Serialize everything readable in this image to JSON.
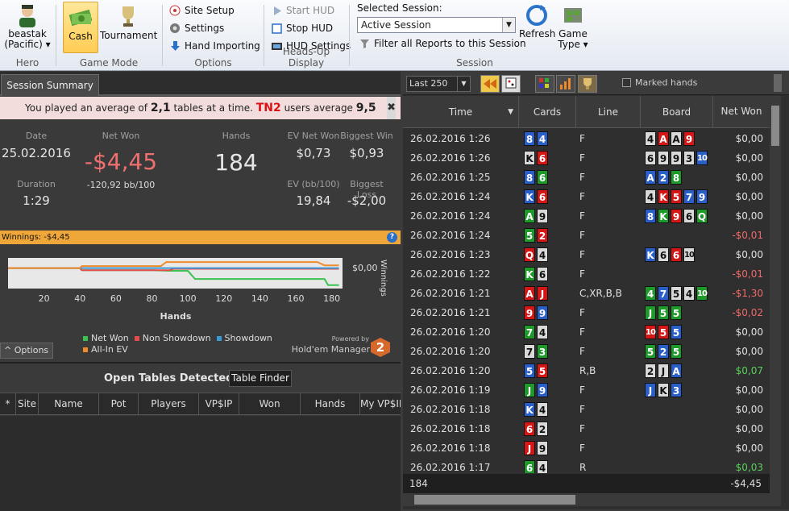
{
  "ribbon": {
    "hero": {
      "name": "beastak",
      "site": "(Pacific)",
      "group": "Hero"
    },
    "game_mode": {
      "cash": "Cash",
      "tournament": "Tournament",
      "group": "Game Mode"
    },
    "options": {
      "site_setup": "Site Setup",
      "settings": "Settings",
      "hand_importing": "Hand Importing",
      "group": "Options"
    },
    "hud": {
      "start": "Start HUD",
      "stop": "Stop HUD",
      "settings": "HUD Settings",
      "group": "Heads-Up Display"
    },
    "session": {
      "label": "Selected Session:",
      "value": "Active Session",
      "filter": "Filter all Reports to this Session",
      "refresh": "Refresh",
      "game_type": "Game Type",
      "group": "Session"
    }
  },
  "summary": {
    "tab": "Session Summary",
    "notice_pre": "You played an average of",
    "notice_tables": "2,1",
    "notice_mid": "tables at a time.",
    "notice_tn": "TN2",
    "notice_post": "users average",
    "notice_avg": "9,5",
    "date_label": "Date",
    "date": "25.02.2016",
    "duration_label": "Duration",
    "duration": "1:29",
    "netwon_label": "Net Won",
    "netwon": "-$4,45",
    "netwon_bb": "-120,92 bb/100",
    "hands_label": "Hands",
    "hands": "184",
    "ev_label": "EV Net Won",
    "ev": "$0,73",
    "evbb_label": "EV (bb/100)",
    "evbb": "19,84",
    "bigwin_label": "Biggest Win",
    "bigwin": "$0,93",
    "bigloss_label": "Biggest Loss",
    "bigloss": "-$2,00",
    "winnings_bar": "Winnings: -$4,45",
    "options": "Options",
    "powered": "Powered by",
    "hm": "Hold'em Manager",
    "hm_num": "2"
  },
  "chart_data": {
    "type": "line",
    "xlabel": "Hands",
    "ylabel": "Winnings",
    "y_tick": "$0,00",
    "x": [
      20,
      40,
      60,
      80,
      100,
      120,
      140,
      160,
      180
    ],
    "xlim": [
      0,
      186
    ],
    "legend": [
      "Net Won",
      "Non Showdown",
      "Showdown",
      "All-In EV"
    ],
    "colors": {
      "net_won": "#3bc24f",
      "non_showdown": "#e34a4a",
      "showdown": "#3a9ad9",
      "allin_ev": "#f08a2a"
    },
    "series": [
      {
        "name": "Net Won",
        "color": "#3bc24f",
        "points": [
          [
            0,
            0
          ],
          [
            40,
            0
          ],
          [
            41,
            -0.3
          ],
          [
            80,
            -0.3
          ],
          [
            90,
            -0.4
          ],
          [
            100,
            -0.4
          ],
          [
            104,
            -1.6
          ],
          [
            176,
            -1.6
          ],
          [
            178,
            -2.5
          ],
          [
            184,
            -2.5
          ]
        ]
      },
      {
        "name": "Non Showdown",
        "color": "#e34a4a",
        "points": [
          [
            0,
            0
          ],
          [
            40,
            0
          ],
          [
            41,
            -0.3
          ],
          [
            90,
            -0.3
          ],
          [
            92,
            -0.1
          ],
          [
            184,
            -0.1
          ]
        ]
      },
      {
        "name": "Showdown",
        "color": "#3a9ad9",
        "points": [
          [
            0,
            0
          ],
          [
            184,
            0
          ]
        ]
      },
      {
        "name": "All-In EV",
        "color": "#f08a2a",
        "points": [
          [
            0,
            0
          ],
          [
            40,
            0
          ],
          [
            41,
            0.3
          ],
          [
            85,
            0.3
          ],
          [
            88,
            0.9
          ],
          [
            172,
            0.9
          ],
          [
            176,
            0.4
          ],
          [
            184,
            0.4
          ]
        ]
      }
    ]
  },
  "open_tables": {
    "title": "Open Tables Detected",
    "finder": "Table Finder",
    "columns": [
      "*",
      "Site",
      "Name",
      "Pot",
      "Players",
      "VP$IP",
      "Won",
      "Hands",
      "My VP$IP"
    ]
  },
  "hands": {
    "filter": "Last 250",
    "marked": "Marked hands",
    "columns": {
      "time": "Time",
      "cards": "Cards",
      "line": "Line",
      "board": "Board",
      "won": "Net Won"
    },
    "footer_count": "184",
    "footer_won": "-$4,45",
    "rows": [
      {
        "time": "26.02.2016 1:26",
        "cards": [
          [
            "8",
            "d"
          ],
          [
            "4",
            "d"
          ]
        ],
        "line": "F",
        "board": [
          [
            "4",
            "x"
          ],
          [
            "A",
            "h"
          ],
          [
            "A",
            "x"
          ],
          [
            "9",
            "h"
          ]
        ],
        "won": "$0,00",
        "cls": "z"
      },
      {
        "time": "26.02.2016 1:26",
        "cards": [
          [
            "K",
            "x"
          ],
          [
            "6",
            "h"
          ]
        ],
        "line": "F",
        "board": [
          [
            "6",
            "x"
          ],
          [
            "9",
            "x"
          ],
          [
            "9",
            "x"
          ],
          [
            "3",
            "x"
          ],
          [
            "10",
            "d"
          ]
        ],
        "won": "$0,00",
        "cls": "z"
      },
      {
        "time": "26.02.2016 1:25",
        "cards": [
          [
            "8",
            "d"
          ],
          [
            "6",
            "c"
          ]
        ],
        "line": "F",
        "board": [
          [
            "A",
            "d"
          ],
          [
            "2",
            "d"
          ],
          [
            "8",
            "c"
          ]
        ],
        "won": "$0,00",
        "cls": "z"
      },
      {
        "time": "26.02.2016 1:24",
        "cards": [
          [
            "K",
            "d"
          ],
          [
            "6",
            "h"
          ]
        ],
        "line": "F",
        "board": [
          [
            "4",
            "x"
          ],
          [
            "K",
            "h"
          ],
          [
            "5",
            "h"
          ],
          [
            "7",
            "d"
          ],
          [
            "9",
            "d"
          ]
        ],
        "won": "$0,00",
        "cls": "z"
      },
      {
        "time": "26.02.2016 1:24",
        "cards": [
          [
            "A",
            "c"
          ],
          [
            "9",
            "x"
          ]
        ],
        "line": "F",
        "board": [
          [
            "8",
            "d"
          ],
          [
            "K",
            "c"
          ],
          [
            "9",
            "h"
          ],
          [
            "6",
            "x"
          ],
          [
            "Q",
            "c"
          ]
        ],
        "won": "$0,00",
        "cls": "z"
      },
      {
        "time": "26.02.2016 1:24",
        "cards": [
          [
            "5",
            "c"
          ],
          [
            "2",
            "h"
          ]
        ],
        "line": "F",
        "board": [],
        "won": "-$0,01",
        "cls": "n"
      },
      {
        "time": "26.02.2016 1:23",
        "cards": [
          [
            "Q",
            "h"
          ],
          [
            "4",
            "x"
          ]
        ],
        "line": "F",
        "board": [
          [
            "K",
            "d"
          ],
          [
            "6",
            "x"
          ],
          [
            "6",
            "h"
          ],
          [
            "10",
            "x"
          ]
        ],
        "won": "$0,00",
        "cls": "z"
      },
      {
        "time": "26.02.2016 1:22",
        "cards": [
          [
            "K",
            "c"
          ],
          [
            "6",
            "x"
          ]
        ],
        "line": "F",
        "board": [],
        "won": "-$0,01",
        "cls": "n"
      },
      {
        "time": "26.02.2016 1:21",
        "cards": [
          [
            "A",
            "h"
          ],
          [
            "J",
            "h"
          ]
        ],
        "line": "C,XR,B,B",
        "board": [
          [
            "4",
            "c"
          ],
          [
            "7",
            "d"
          ],
          [
            "5",
            "x"
          ],
          [
            "4",
            "x"
          ],
          [
            "10",
            "c"
          ]
        ],
        "won": "-$1,30",
        "cls": "n"
      },
      {
        "time": "26.02.2016 1:21",
        "cards": [
          [
            "9",
            "h"
          ],
          [
            "9",
            "d"
          ]
        ],
        "line": "F",
        "board": [
          [
            "J",
            "c"
          ],
          [
            "5",
            "c"
          ],
          [
            "5",
            "c"
          ]
        ],
        "won": "-$0,02",
        "cls": "n"
      },
      {
        "time": "26.02.2016 1:20",
        "cards": [
          [
            "7",
            "c"
          ],
          [
            "4",
            "x"
          ]
        ],
        "line": "F",
        "board": [
          [
            "10",
            "h"
          ],
          [
            "5",
            "h"
          ],
          [
            "5",
            "d"
          ]
        ],
        "won": "$0,00",
        "cls": "z"
      },
      {
        "time": "26.02.2016 1:20",
        "cards": [
          [
            "7",
            "x"
          ],
          [
            "3",
            "c"
          ]
        ],
        "line": "F",
        "board": [
          [
            "5",
            "c"
          ],
          [
            "2",
            "d"
          ],
          [
            "5",
            "c"
          ]
        ],
        "won": "$0,00",
        "cls": "z"
      },
      {
        "time": "26.02.2016 1:20",
        "cards": [
          [
            "5",
            "d"
          ],
          [
            "5",
            "h"
          ]
        ],
        "line": "R,B",
        "board": [
          [
            "2",
            "x"
          ],
          [
            "J",
            "x"
          ],
          [
            "A",
            "d"
          ]
        ],
        "won": "$0,07",
        "cls": "p"
      },
      {
        "time": "26.02.2016 1:19",
        "cards": [
          [
            "J",
            "c"
          ],
          [
            "9",
            "d"
          ]
        ],
        "line": "F",
        "board": [
          [
            "J",
            "d"
          ],
          [
            "K",
            "x"
          ],
          [
            "3",
            "d"
          ]
        ],
        "won": "$0,00",
        "cls": "z"
      },
      {
        "time": "26.02.2016 1:18",
        "cards": [
          [
            "K",
            "d"
          ],
          [
            "4",
            "x"
          ]
        ],
        "line": "F",
        "board": [],
        "won": "$0,00",
        "cls": "z"
      },
      {
        "time": "26.02.2016 1:18",
        "cards": [
          [
            "6",
            "h"
          ],
          [
            "2",
            "x"
          ]
        ],
        "line": "F",
        "board": [],
        "won": "$0,00",
        "cls": "z"
      },
      {
        "time": "26.02.2016 1:18",
        "cards": [
          [
            "J",
            "h"
          ],
          [
            "9",
            "x"
          ]
        ],
        "line": "F",
        "board": [],
        "won": "$0,00",
        "cls": "z"
      },
      {
        "time": "26.02.2016 1:17",
        "cards": [
          [
            "6",
            "c"
          ],
          [
            "4",
            "x"
          ]
        ],
        "line": "R",
        "board": [],
        "won": "$0,03",
        "cls": "p"
      }
    ]
  }
}
